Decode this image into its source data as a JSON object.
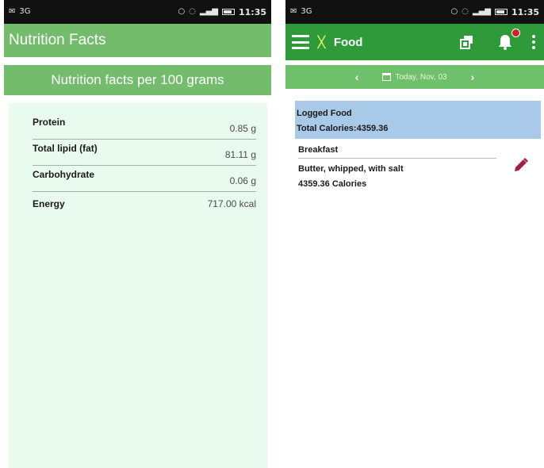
{
  "left_screen": {
    "status_bar": {
      "signal_text": "3G",
      "time": "11:35"
    },
    "appbar": {
      "title": "Nutrition Facts"
    },
    "subheader": "Nutrition facts per 100 grams",
    "nutrients": [
      {
        "label": "Protein",
        "value": "0.85 g"
      },
      {
        "label": "Total lipid (fat)",
        "value": "81.11 g"
      },
      {
        "label": "Carbohydrate",
        "value": "0.06 g"
      },
      {
        "label": "Energy",
        "value": "717.00 kcal"
      }
    ]
  },
  "right_screen": {
    "status_bar": {
      "signal_text": "3G",
      "time": "11:35"
    },
    "appbar": {
      "title": "Food",
      "icons": [
        "menu-icon",
        "runner-icon",
        "foods-icon",
        "notification-bell-icon",
        "more-vert-icon"
      ]
    },
    "date_bar": {
      "prev": "‹",
      "date": "Today, Nov, 03",
      "next": "›"
    },
    "logged": {
      "title": "Logged Food",
      "total": "Total Calories:4359.36"
    },
    "meals": [
      {
        "meal": "Breakfast",
        "food": "Butter, whipped, with salt",
        "calories": "4359.36 Calories"
      }
    ]
  },
  "colors": {
    "status_bar": "#111111",
    "nf_green": "#73bc6c",
    "food_appbar_green": "#2e9a3a",
    "date_bar_green": "#6fc06a",
    "card_bg": "#e9fbee",
    "logged_bg": "#a9c9e8",
    "edit_icon": "#a0204a",
    "badge_red": "#d0212a"
  }
}
